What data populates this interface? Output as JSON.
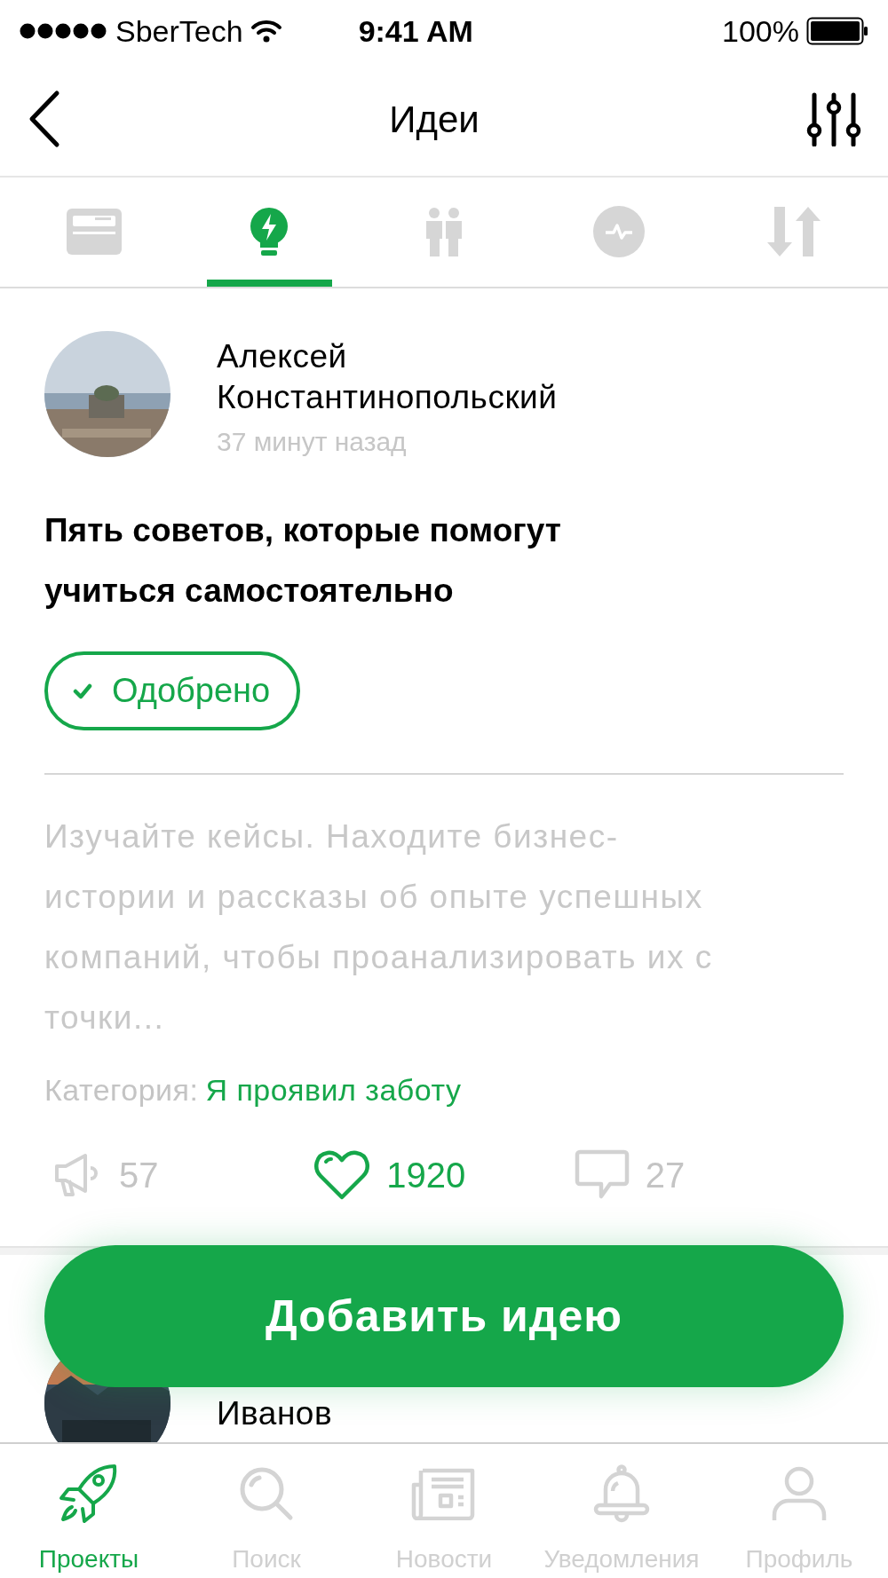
{
  "status_bar": {
    "carrier": "SberTech",
    "time": "9:41 AM",
    "battery": "100%"
  },
  "nav": {
    "title": "Идеи"
  },
  "tabs": [
    {
      "kind": "card",
      "selected": false
    },
    {
      "kind": "idea",
      "selected": true
    },
    {
      "kind": "people",
      "selected": false
    },
    {
      "kind": "pulse",
      "selected": false
    },
    {
      "kind": "exchange",
      "selected": false
    }
  ],
  "post": {
    "author": "Алексей Константинопольский",
    "time": "37 минут назад",
    "title": "Пять советов, которые помогут учиться самостоятельно",
    "status": {
      "label": "Одобрено",
      "approved": true
    },
    "text": "Изучайте кейсы. Находите бизнес-истории и рассказы об опыте успешных компаний, чтобы проанализировать их с точки...",
    "category_label": "Категория:",
    "category": "Я проявил заботу",
    "stats": [
      {
        "kind": "megaphone",
        "count": "57",
        "active": false
      },
      {
        "kind": "heart",
        "count": "1920",
        "active": true
      },
      {
        "kind": "comment",
        "count": "27",
        "active": false
      }
    ]
  },
  "next_post": {
    "author": "Иванов"
  },
  "add_button": "Добавить идею",
  "tab_bar": [
    {
      "kind": "rocket",
      "label": "Проекты",
      "selected": true
    },
    {
      "kind": "search",
      "label": "Поиск",
      "selected": false
    },
    {
      "kind": "news",
      "label": "Новости",
      "selected": false
    },
    {
      "kind": "bell",
      "label": "Уведомления",
      "selected": false
    },
    {
      "kind": "profile",
      "label": "Профиль",
      "selected": false
    }
  ]
}
